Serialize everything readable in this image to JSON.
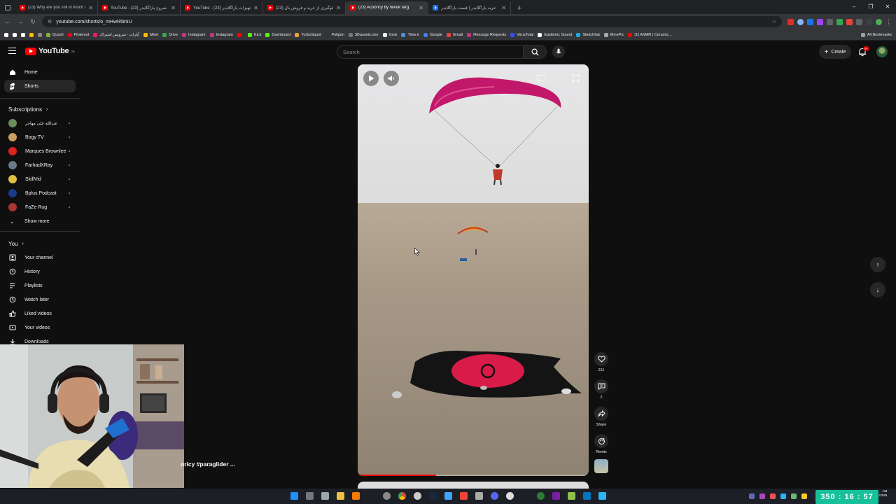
{
  "browser": {
    "tabs": [
      {
        "title": "(23) Why are you still in touch w",
        "favicon": "youtube-icon"
      },
      {
        "title": "YouTube - شروع پاراگلایدر (23)",
        "favicon": "youtube-icon"
      },
      {
        "title": "YouTube - تجهیزات پاراگلایدر (23)",
        "favicon": "youtube-icon"
      },
      {
        "title": "جلوگیری از خرید و فروش بال (23)",
        "favicon": "youtube-icon"
      },
      {
        "title": "(23) Acooricy by niviuk targ",
        "favicon": "youtube-icon",
        "active": true
      },
      {
        "title": "خرید پاراگلایدر | قیمت پاراگلایدر",
        "favicon": "site-icon"
      }
    ],
    "url": "youtube.com/shorts/o_mHwRt9niU",
    "bookmarks": [
      "Quizel",
      "Pinterest",
      "آپارات - سرویس اشتراک",
      "Meet",
      "Drive",
      "Instagram",
      "Instagram",
      "",
      "Kick",
      "Dashboard",
      "TurboSquid",
      "Poligon",
      "3Dassets.one",
      "Grok",
      "Time.ir",
      "Google",
      "Gmail",
      "Message Requests",
      "VirusTotal",
      "Epidemic Sound",
      "Sketchfab",
      "MinePic",
      "(1) ASMR | Ceramic..."
    ],
    "all_bookmarks": "All Bookmarks"
  },
  "yt": {
    "logo": "YouTube",
    "region": "GB",
    "search_placeholder": "Search",
    "create_label": "Create",
    "notif_count": "9+"
  },
  "sidebar": {
    "main": [
      {
        "label": "Home",
        "icon": "home-icon"
      },
      {
        "label": "Shorts",
        "icon": "shorts-icon",
        "active": true
      }
    ],
    "subs_title": "Subscriptions",
    "subs": [
      {
        "label": "عبدالله علی مهاجر",
        "color": "#6b8e5a"
      },
      {
        "label": "Bogy TV",
        "color": "#c8a060"
      },
      {
        "label": "Marques Brownlee",
        "color": "#d22"
      },
      {
        "label": "FarhadXRay",
        "color": "#6a7a8a"
      },
      {
        "label": "SkillVid",
        "color": "#e0c040"
      },
      {
        "label": "Bplus Podcast",
        "color": "#1a3a8a"
      },
      {
        "label": "FaZe Rug",
        "color": "#a33"
      }
    ],
    "show_more": "Show more",
    "you_title": "You",
    "you": [
      {
        "label": "Your channel",
        "icon": "channel-icon"
      },
      {
        "label": "History",
        "icon": "history-icon"
      },
      {
        "label": "Playlists",
        "icon": "playlists-icon"
      },
      {
        "label": "Watch later",
        "icon": "clock-icon"
      },
      {
        "label": "Liked videos",
        "icon": "like-icon"
      },
      {
        "label": "Your videos",
        "icon": "video-icon"
      },
      {
        "label": "Downloads",
        "icon": "download-icon"
      }
    ]
  },
  "short": {
    "caption": "oricy #paraglider ...",
    "progress": 0.34,
    "actions": {
      "likes": "211",
      "comments": "2",
      "share": "Share",
      "remix": "Remix"
    }
  },
  "taskbar": {
    "clock_overlay": "350 : 16 : 57",
    "tray_time": "AM",
    "tray_date": "/2026"
  }
}
